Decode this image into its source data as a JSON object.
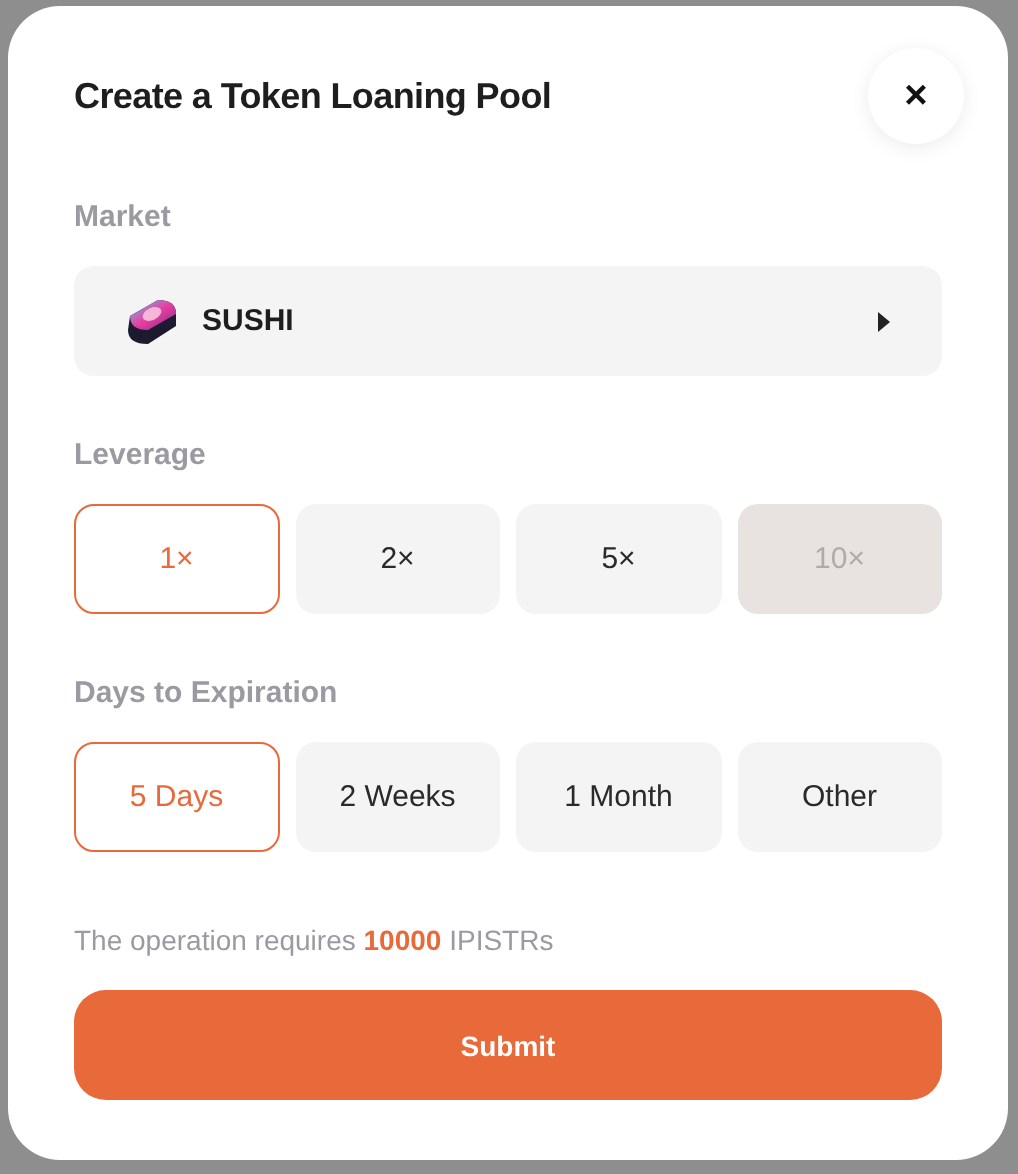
{
  "dialog": {
    "title": "Create a Token Loaning Pool",
    "close": "×"
  },
  "market": {
    "label": "Market",
    "value": "SUSHI"
  },
  "leverage": {
    "label": "Leverage",
    "options": [
      {
        "label": "1×",
        "selected": true,
        "disabled": false
      },
      {
        "label": "2×",
        "selected": false,
        "disabled": false
      },
      {
        "label": "5×",
        "selected": false,
        "disabled": false
      },
      {
        "label": "10×",
        "selected": false,
        "disabled": true
      }
    ]
  },
  "expiration": {
    "label": "Days to Expiration",
    "options": [
      {
        "label": "5 Days",
        "selected": true,
        "disabled": false
      },
      {
        "label": "2 Weeks",
        "selected": false,
        "disabled": false
      },
      {
        "label": "1 Month",
        "selected": false,
        "disabled": false
      },
      {
        "label": "Other",
        "selected": false,
        "disabled": false
      }
    ]
  },
  "requirement": "The operation requires **10000** IPISTRs",
  "submit": "Submit"
}
